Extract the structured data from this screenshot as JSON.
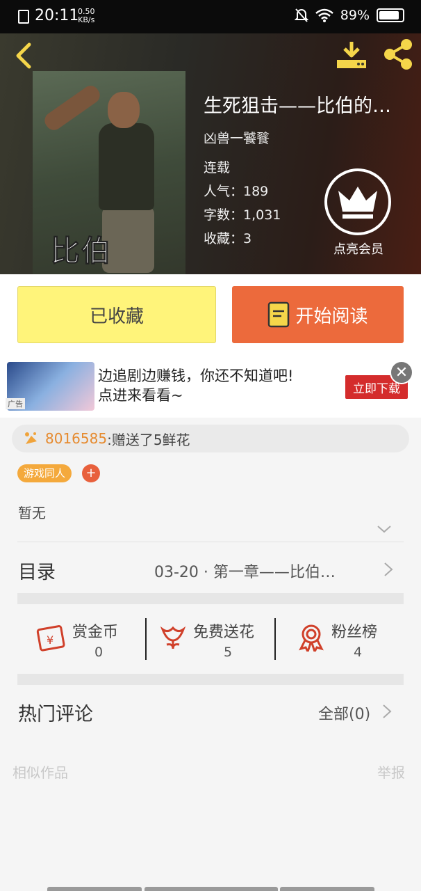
{
  "status_bar": {
    "time": "20:11",
    "net_speed": "0.50",
    "net_unit": "KB/s",
    "battery": "89%",
    "battery_level": 0.89
  },
  "book": {
    "title": "生死狙击——比伯的…",
    "author": "凶兽一饕餮",
    "status": "连载",
    "popularity": "人气：189",
    "word_count": "字数：1,031",
    "favorites": "收藏：3",
    "cover_text": "比伯",
    "vip_label": "点亮会员"
  },
  "actions": {
    "collected_label": "已收藏",
    "read_label": "开始阅读"
  },
  "ad": {
    "text_line1": "边追剧边赚钱，你还不知道吧!",
    "text_line2": "点进来看看~",
    "tag": "广告",
    "cta": "立即下载",
    "close_symbol": "✕"
  },
  "gift": {
    "user_id": "8016585",
    "message": ":赠送了5鲜花"
  },
  "tags": {
    "genre": "游戏同人",
    "add_symbol": "+"
  },
  "intro": {
    "text": "暂无"
  },
  "toc": {
    "label": "目录",
    "latest": "03-20 · 第一章——比伯…"
  },
  "stats": {
    "reward": {
      "label": "赏金币",
      "value": "0"
    },
    "flowers": {
      "label": "免费送花",
      "value": "5"
    },
    "fans": {
      "label": "粉丝榜",
      "value": "4"
    }
  },
  "comments": {
    "label": "热门评论",
    "all": "全部(0)"
  },
  "footer": {
    "similar": "相似作品",
    "report": "举报"
  },
  "colors": {
    "accent_yellow": "#fff47a",
    "accent_orange": "#ec6a3c",
    "header_icon": "#f5d64a",
    "stat_icon": "#d0402a"
  }
}
